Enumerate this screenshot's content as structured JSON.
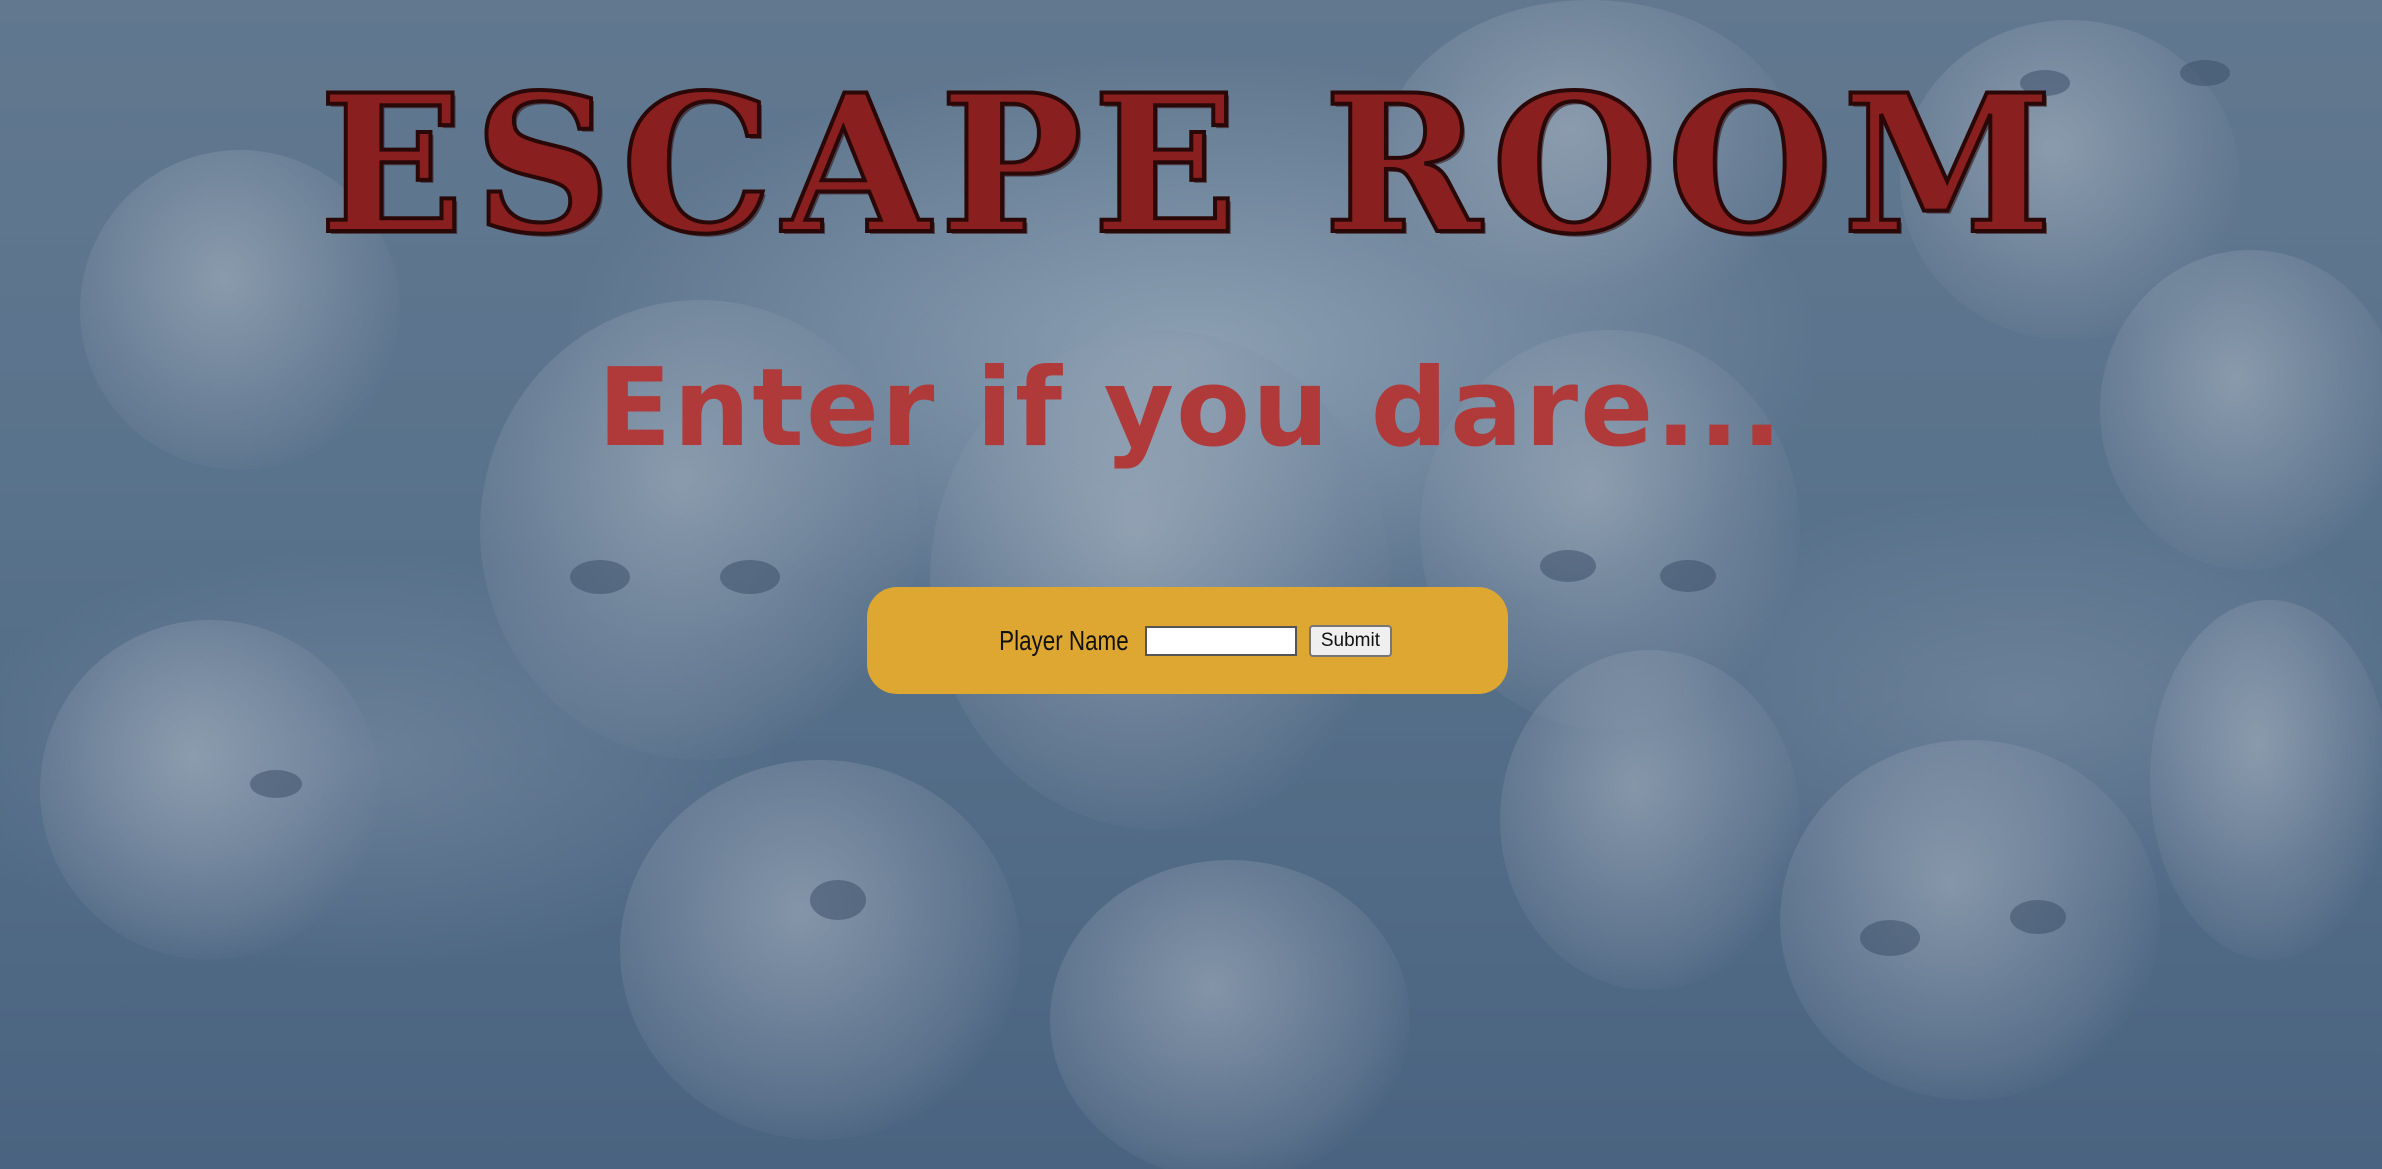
{
  "page": {
    "title": "ESCAPE ROOM",
    "tagline": "Enter if you dare..."
  },
  "form": {
    "player_label": "Player Name",
    "player_value": "",
    "submit_label": "Submit"
  },
  "colors": {
    "title": "#8a1f1f",
    "tagline": "#b03a3a",
    "panel": "#dea732",
    "background": "#4e6881"
  },
  "background": {
    "description_icon": "doll-faces-background"
  }
}
